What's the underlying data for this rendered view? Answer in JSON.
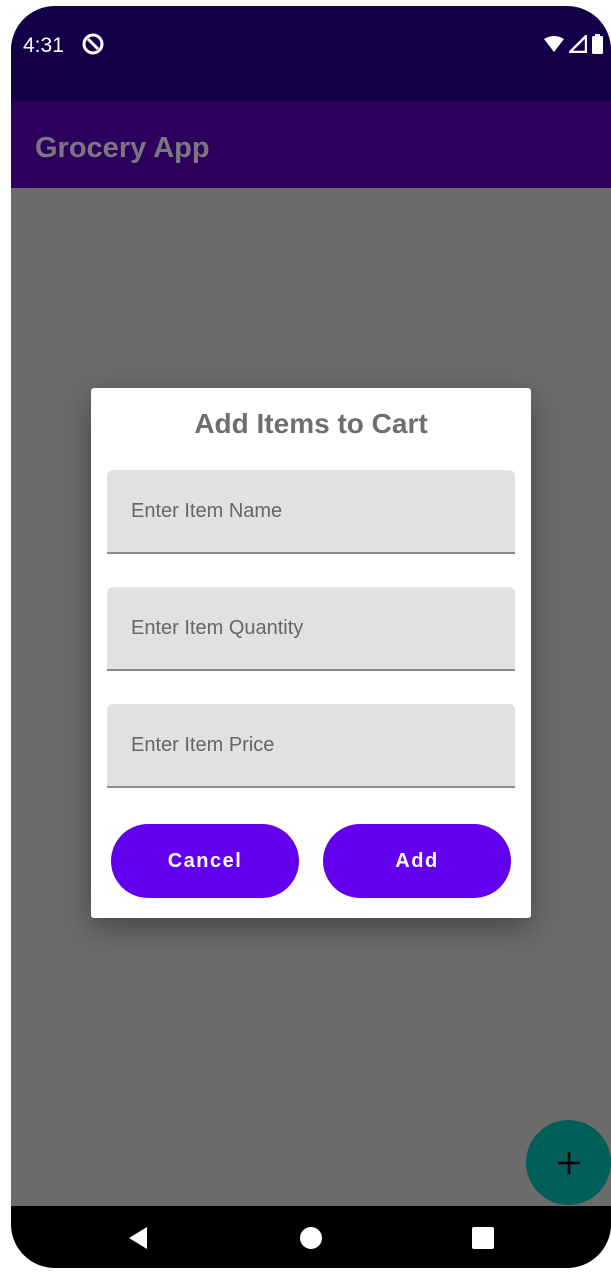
{
  "status_bar": {
    "time": "4:31"
  },
  "app_bar": {
    "title": "Grocery App"
  },
  "dialog": {
    "title": "Add Items to Cart",
    "fields": [
      {
        "placeholder": "Enter Item Name",
        "value": ""
      },
      {
        "placeholder": "Enter Item Quantity",
        "value": ""
      },
      {
        "placeholder": "Enter Item Price",
        "value": ""
      }
    ],
    "cancel_label": "Cancel",
    "add_label": "Add"
  },
  "fab": {
    "icon": "plus-icon"
  },
  "nav": {
    "back_icon": "back-icon",
    "home_icon": "home-icon",
    "recents_icon": "recents-icon"
  },
  "colors": {
    "status_bar": "#140048",
    "app_bar": "#2c005c",
    "primary": "#6200ee",
    "fab": "#015f5a",
    "scrim": "#6b6b6b"
  }
}
